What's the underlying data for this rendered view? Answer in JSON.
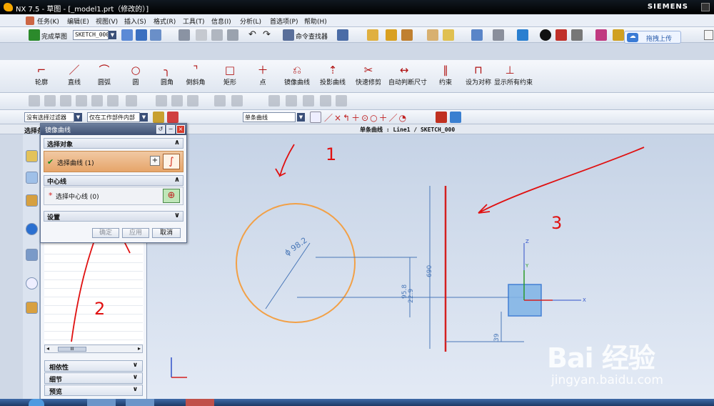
{
  "window": {
    "title": "NX 7.5 - 草图 - [_model1.prt（修改的）]",
    "brand": "SIEMENS"
  },
  "menu": [
    "任务(K)",
    "编辑(E)",
    "视图(V)",
    "插入(S)",
    "格式(R)",
    "工具(T)",
    "信息(I)",
    "分析(L)",
    "首选项(P)",
    "帮助(H)"
  ],
  "upload": {
    "label": "拖拽上传"
  },
  "toolbar1": {
    "finish_sketch": "完成草图",
    "sketch_name": "SKETCH_000",
    "command_finder": "命令查找器"
  },
  "sketch_tools": [
    {
      "label": "轮廓",
      "glyph": "⌐"
    },
    {
      "label": "直线",
      "glyph": "／"
    },
    {
      "label": "圆弧",
      "glyph": "⌒"
    },
    {
      "label": "圆",
      "glyph": "○"
    },
    {
      "label": "圆角",
      "glyph": "╮"
    },
    {
      "label": "倒斜角",
      "glyph": "⌝"
    },
    {
      "label": "矩形",
      "glyph": "□"
    },
    {
      "label": "点",
      "glyph": "＋"
    },
    {
      "label": "镜像曲线",
      "glyph": "⎌"
    },
    {
      "label": "投影曲线",
      "glyph": "⇡"
    },
    {
      "label": "快速修剪",
      "glyph": "✂"
    },
    {
      "label": "自动判断尺寸",
      "glyph": "↔"
    },
    {
      "label": "约束",
      "glyph": "∥"
    },
    {
      "label": "设为对称",
      "glyph": "⊓"
    },
    {
      "label": "显示所有约束",
      "glyph": "⊥"
    }
  ],
  "filter_bar": {
    "filter": "没有选择过滤器",
    "scope": "仅在工作部件内部",
    "curve_rule": "单条曲线"
  },
  "status": {
    "selection_label": "选择条",
    "message": "单条曲线 : Line1 / SKETCH_000"
  },
  "dialog": {
    "title": "镜像曲线",
    "section1": "选择对象",
    "select_curve": "选择曲线 (1)",
    "section2": "中心线",
    "select_centerline": "选择中心线 (0)",
    "section3": "设置",
    "ok": "确定",
    "apply": "应用",
    "cancel": "取消"
  },
  "nav_sections": [
    "相依性",
    "细节",
    "预览"
  ],
  "drawing": {
    "diameter_label": "ϕ 98.2",
    "dim_vertical_1": "690",
    "dim_vertical_2": "95.8",
    "dim_vertical_3": "22.9",
    "dim_horizontal": "39",
    "annotations": [
      "1",
      "2",
      "3"
    ],
    "axis_labels": [
      "Z",
      "Y",
      "X"
    ],
    "colors": {
      "circle": "#f2a046",
      "line": "#d42020",
      "annotation": "#e01010",
      "dimension": "#4a78b8"
    }
  },
  "watermark": {
    "logo": "Bai  经验",
    "url": "jingyan.baidu.com"
  }
}
